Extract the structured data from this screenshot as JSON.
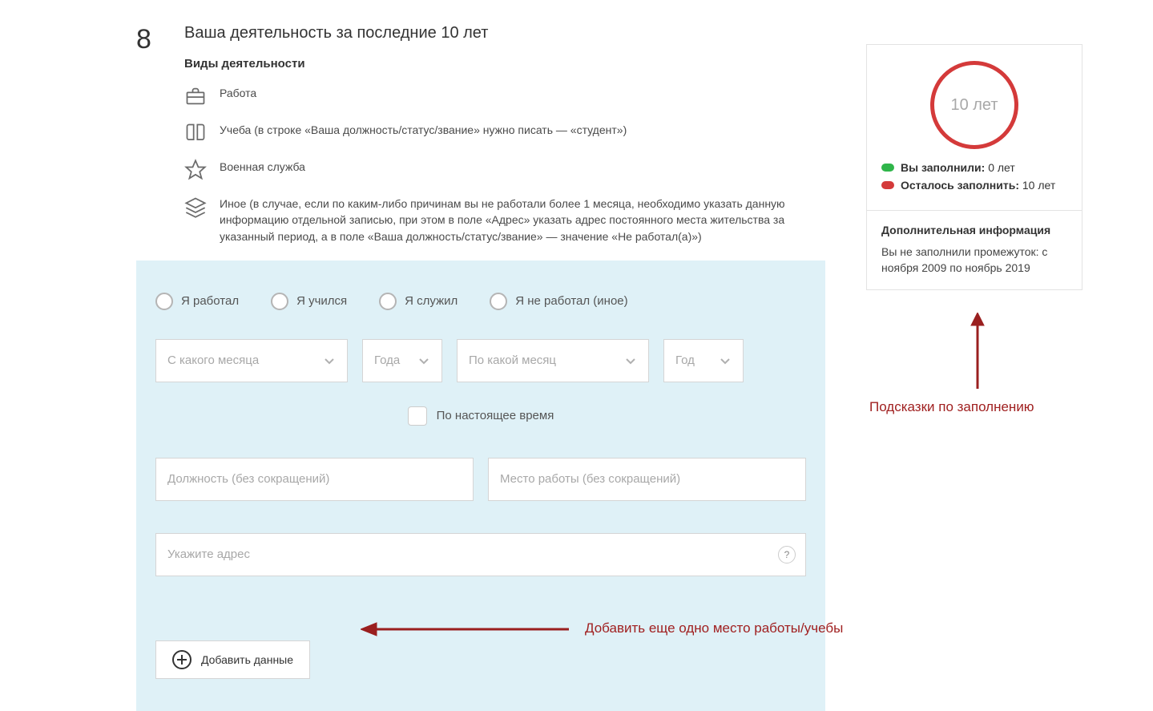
{
  "step": "8",
  "title": "Ваша деятельность за последние 10 лет",
  "subheader": "Виды деятельности",
  "types": {
    "work": "Работа",
    "study": "Учеба (в строке «Ваша должность/статус/звание» нужно писать — «студент»)",
    "military": "Военная служба",
    "other": "Иное (в случае, если по каким-либо причинам вы не работали более 1 месяца, необходимо указать данную информацию отдельной записью, при этом в поле «Адрес» указать адрес постоянного места жительства за указанный период, а в поле «Ваша должность/статус/звание» — значение «Не работал(а)»)"
  },
  "radios": {
    "worked": "Я работал",
    "studied": "Я учился",
    "served": "Я служил",
    "none": "Я не работал (иное)"
  },
  "selects": {
    "from_month": "С какого месяца",
    "from_year": "Года",
    "to_month": "По какой месяц",
    "to_year": "Год"
  },
  "present_cb": "По настоящее время",
  "inputs": {
    "position": "Должность (без сокращений)",
    "place": "Место работы (без сокращений)",
    "address": "Укажите адрес"
  },
  "help_q": "?",
  "add_button": "Добавить данные",
  "sidebar": {
    "circle_label": "10 лет",
    "filled_label": "Вы заполнили:",
    "filled_value": "0 лет",
    "remain_label": "Осталось заполнить:",
    "remain_value": "10 лет",
    "info_header": "Дополнительная информация",
    "info_text": "Вы не заполнили промежуток: с ноября 2009 по ноябрь 2019"
  },
  "annotations": {
    "hints": "Подсказки по заполнению",
    "add_more": "Добавить еще одно место работы/учебы"
  }
}
